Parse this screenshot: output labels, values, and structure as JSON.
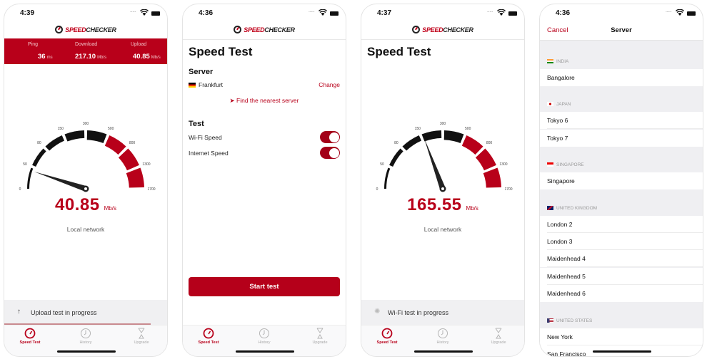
{
  "colors": {
    "brand": "#b8001a",
    "gauge_dark": "#111111"
  },
  "brand": {
    "logo_red": "SPEED",
    "logo_dark": "CHECKER"
  },
  "gauge_labels": [
    "0",
    "50",
    "80",
    "150",
    "300",
    "500",
    "800",
    "1300",
    "1700"
  ],
  "tabs": [
    {
      "label": "Speed Test",
      "icon": "speedometer-icon"
    },
    {
      "label": "History",
      "icon": "clock-icon"
    },
    {
      "label": "Upgrade",
      "icon": "hourglass-star-icon"
    }
  ],
  "screen1": {
    "time": "4:39",
    "stats": [
      {
        "label": "Ping",
        "value": "36",
        "unit": "ms"
      },
      {
        "label": "Download",
        "value": "217.10",
        "unit": "Mb/s"
      },
      {
        "label": "Upload",
        "value": "40.85",
        "unit": "Mb/s"
      }
    ],
    "speed_value": "40.85",
    "speed_unit": "Mb/s",
    "needle_mbps": 40.85,
    "network": "Local network",
    "progress_text": "Upload test in progress",
    "progress_icon": "arrow-up-icon",
    "progress_fraction": 0.9
  },
  "screen2": {
    "time": "4:36",
    "title": "Speed Test",
    "server_heading": "Server",
    "server_name": "Frankfurt",
    "change_label": "Change",
    "find_label": "Find the nearest server",
    "test_heading": "Test",
    "toggles": [
      {
        "label": "Wi-Fi Speed",
        "on": true
      },
      {
        "label": "Internet Speed",
        "on": true
      }
    ],
    "start_label": "Start test"
  },
  "screen3": {
    "time": "4:37",
    "title": "Speed Test",
    "speed_value": "165.55",
    "speed_unit": "Mb/s",
    "needle_mbps": 165.55,
    "network": "Local network",
    "progress_text": "Wi-Fi test in progress",
    "progress_icon": "spinner-icon"
  },
  "screen4": {
    "time": "4:36",
    "cancel_label": "Cancel",
    "title": "Server",
    "groups": [
      {
        "country": "INDIA",
        "servers": [
          "Bangalore"
        ]
      },
      {
        "country": "JAPAN",
        "servers": [
          "Tokyo 6",
          "Tokyo 7"
        ]
      },
      {
        "country": "SINGAPORE",
        "servers": [
          "Singapore"
        ]
      },
      {
        "country": "UNITED KINGDOM",
        "servers": [
          "London 2",
          "London 3",
          "Maidenhead 4",
          "Maidenhead 5",
          "Maidenhead 6"
        ]
      },
      {
        "country": "UNITED STATES",
        "servers": [
          "New York",
          "San Francisco"
        ]
      }
    ]
  }
}
